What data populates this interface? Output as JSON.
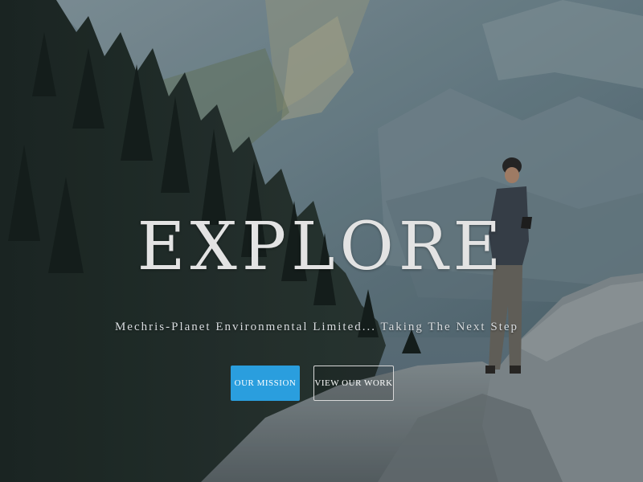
{
  "hero": {
    "title": "EXPLORE",
    "tagline": "Mechris-Planet Environmental Limited... Taking The Next Step",
    "buttons": {
      "primary_label": "OUR MISSION",
      "secondary_label": "VIEW OUR WORK"
    },
    "background": {
      "icon": "mountain-landscape-with-hiker"
    },
    "colors": {
      "primary_button": "#2a9ede",
      "title_text": "#e3e3e3",
      "button_text": "#ffffff"
    }
  }
}
